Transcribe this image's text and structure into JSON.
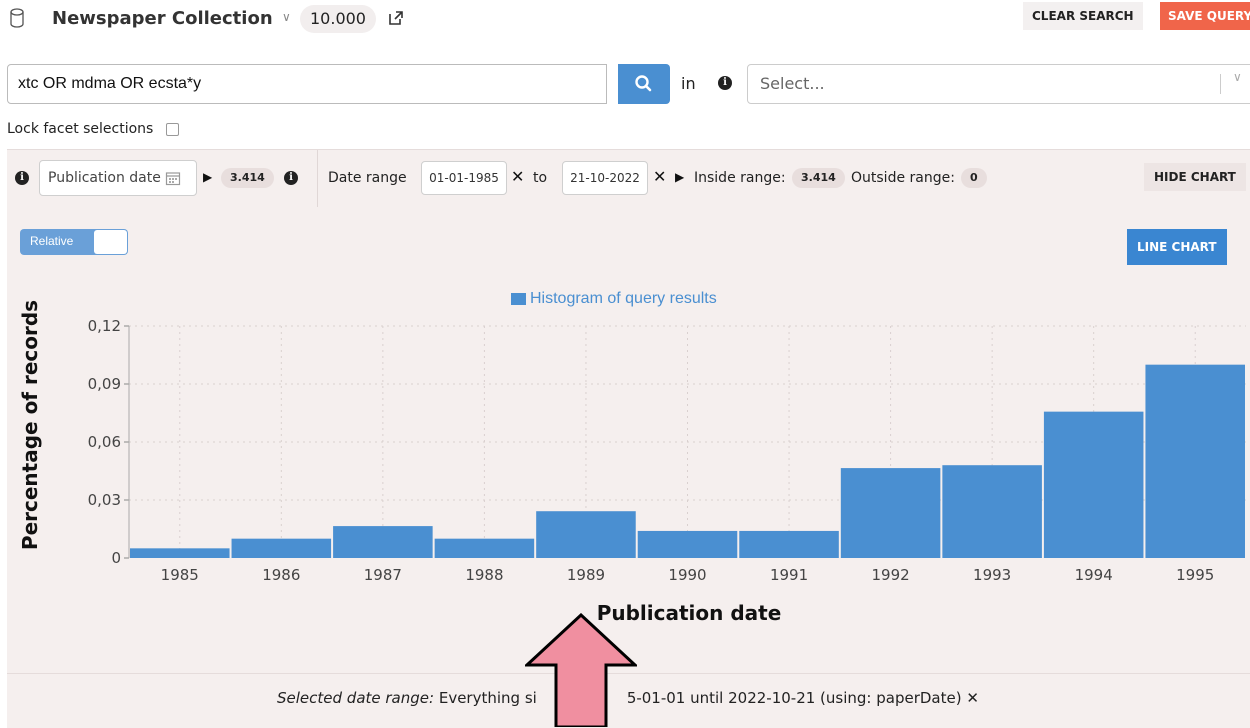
{
  "header": {
    "collection_title": "Newspaper Collection",
    "count": "10.000",
    "clear_label": "CLEAR SEARCH",
    "save_label": "SAVE QUERY",
    "icons": [
      "database-icon",
      "chevron-down-icon",
      "external-link-icon"
    ]
  },
  "search": {
    "query": "xtc OR mdma OR ecsta*y",
    "in_label": "in",
    "field_placeholder": "Select..."
  },
  "lock": {
    "label": "Lock facet selections",
    "checked": false
  },
  "facet": {
    "field": "Publication date",
    "count": "3.414",
    "range_label": "Date range",
    "from": "01-01-1985",
    "to_label": "to",
    "to": "21-10-2022",
    "inside_label": "Inside range:",
    "inside_count": "3.414",
    "outside_label": "Outside range:",
    "outside_count": "0",
    "hide_label": "HIDE CHART"
  },
  "chart_controls": {
    "toggle_label": "Relative",
    "line_chart_label": "LINE CHART"
  },
  "chart_data": {
    "type": "bar",
    "title": "",
    "legend": "Histogram of query results",
    "xlabel": "Publication date",
    "ylabel": "Percentage of records",
    "categories": [
      "1985",
      "1986",
      "1987",
      "1988",
      "1989",
      "1990",
      "1991",
      "1992",
      "1993",
      "1994",
      "1995"
    ],
    "values": [
      0.005,
      0.01,
      0.0165,
      0.01,
      0.0242,
      0.014,
      0.014,
      0.0465,
      0.048,
      0.0757,
      0.1
    ],
    "yticks": [
      "0",
      "0,03",
      "0,06",
      "0,09",
      "0,12"
    ],
    "ylim": [
      0,
      0.12
    ],
    "grid": true,
    "color": "#4a8fd1"
  },
  "selected_range": {
    "label": "Selected date range:",
    "text_before": "Everything si",
    "text_after": "5-01-01 until 2022-10-21 (using: paperDate)"
  }
}
